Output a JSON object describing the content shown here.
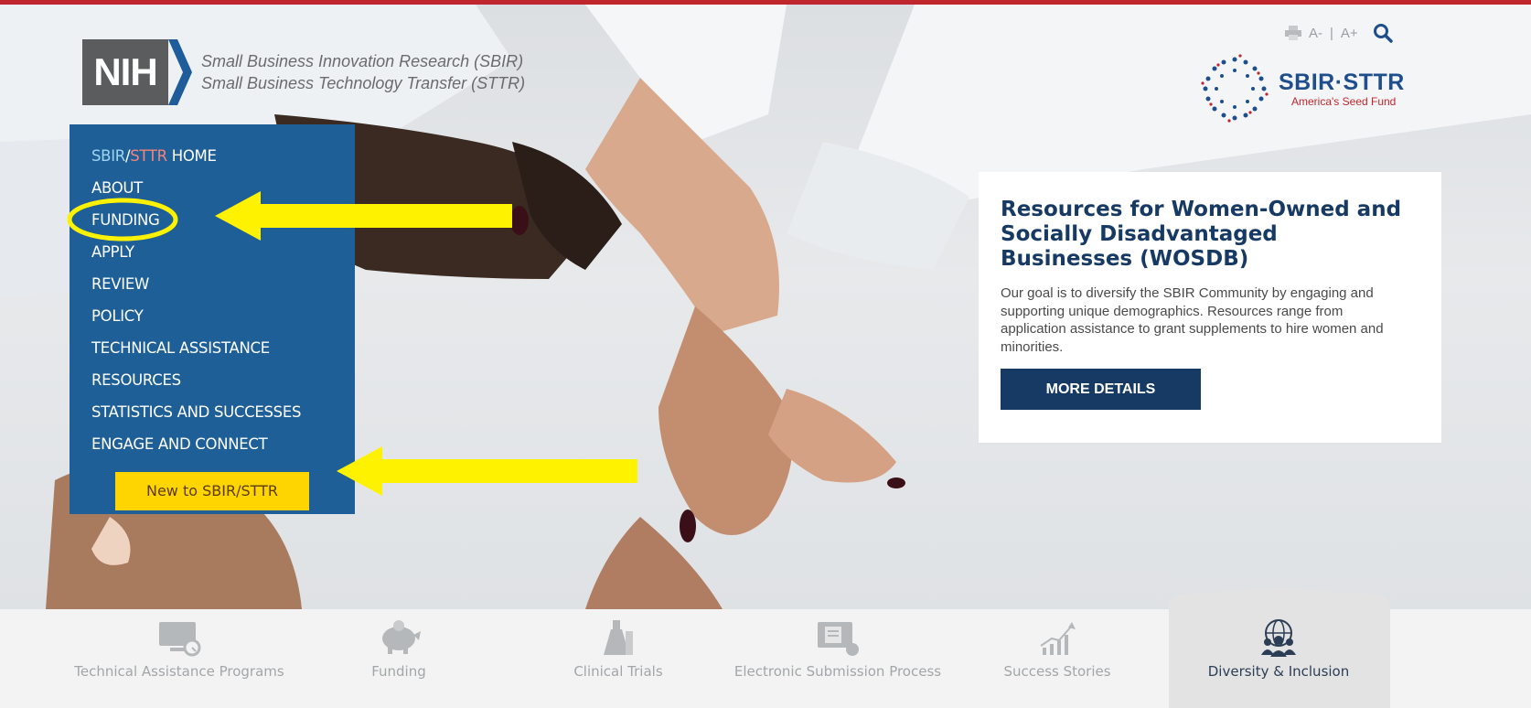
{
  "header": {
    "logo_text": "NIH",
    "program_line1": "Small Business Innovation Research (SBIR)",
    "program_line2": "Small Business Technology Transfer (STTR)"
  },
  "utility": {
    "font_smaller": "A-",
    "separator": "|",
    "font_larger": "A+"
  },
  "seed_logo": {
    "title": "SBIR·STTR",
    "subtitle": "America's Seed Fund"
  },
  "nav": {
    "home": {
      "sbir": "SBIR",
      "slash": "/",
      "sttr": "STTR",
      "rest": " HOME"
    },
    "items": [
      {
        "label": "ABOUT"
      },
      {
        "label": "FUNDING"
      },
      {
        "label": "APPLY"
      },
      {
        "label": "REVIEW"
      },
      {
        "label": "POLICY"
      },
      {
        "label": "TECHNICAL ASSISTANCE"
      },
      {
        "label": "RESOURCES"
      },
      {
        "label": "STATISTICS AND SUCCESSES"
      },
      {
        "label": "ENGAGE AND CONNECT"
      }
    ],
    "cta": "New to SBIR/STTR"
  },
  "card": {
    "title": "Resources for Women-Owned and Socially Disadvantaged Businesses (WOSDB)",
    "body": "Our goal is to diversify the SBIR Community by engaging and supporting unique demographics. Resources range from application assistance to grant supplements to hire women and minorities.",
    "button": "MORE DETAILS"
  },
  "features": [
    {
      "label": "Technical Assistance Programs",
      "icon": "monitor-icon"
    },
    {
      "label": "Funding",
      "icon": "piggy-bank-icon"
    },
    {
      "label": "Clinical Trials",
      "icon": "lab-flask-icon"
    },
    {
      "label": "Electronic Submission Process",
      "icon": "screen-document-icon"
    },
    {
      "label": "Success Stories",
      "icon": "growth-chart-icon"
    },
    {
      "label": "Diversity & Inclusion",
      "icon": "globe-people-icon",
      "active": true
    }
  ],
  "colors": {
    "top_bar": "#c0272d",
    "nav_bg": "#1e5f97",
    "cta_yellow": "#ffd500",
    "card_title": "#163a63",
    "annotation_yellow": "#fff200"
  }
}
